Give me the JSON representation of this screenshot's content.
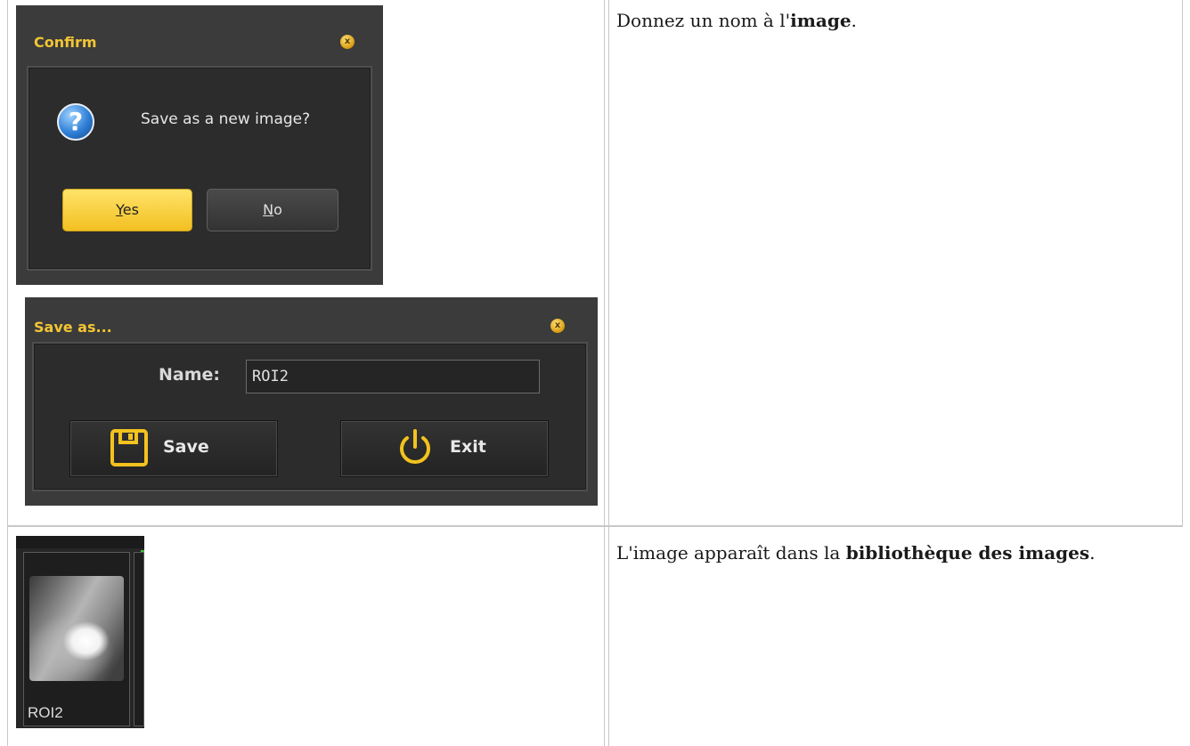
{
  "row1": {
    "text_before": "Donnez un nom à l'",
    "text_bold": "image",
    "text_after": "."
  },
  "confirm_dialog": {
    "title": "Confirm",
    "close_glyph": "x",
    "icon": "question-icon",
    "message": "Save as a new image?",
    "yes": {
      "mnemonic": "Y",
      "rest": "es"
    },
    "no": {
      "mnemonic": "N",
      "rest": "o"
    }
  },
  "save_dialog": {
    "title": "Save as...",
    "close_glyph": "x",
    "name_label": "Name:",
    "name_value": "ROI2",
    "save_label": "Save",
    "exit_label": "Exit",
    "save_icon": "floppy-disk-icon",
    "exit_icon": "power-icon"
  },
  "row2": {
    "text_before": "L'image apparaît dans la ",
    "text_bold": "bibliothèque des images",
    "text_after": "."
  },
  "library": {
    "thumbnail_caption": "ROI2"
  },
  "colors": {
    "accent_yellow": "#f2c534",
    "dialog_bg": "#3b3b3b"
  }
}
